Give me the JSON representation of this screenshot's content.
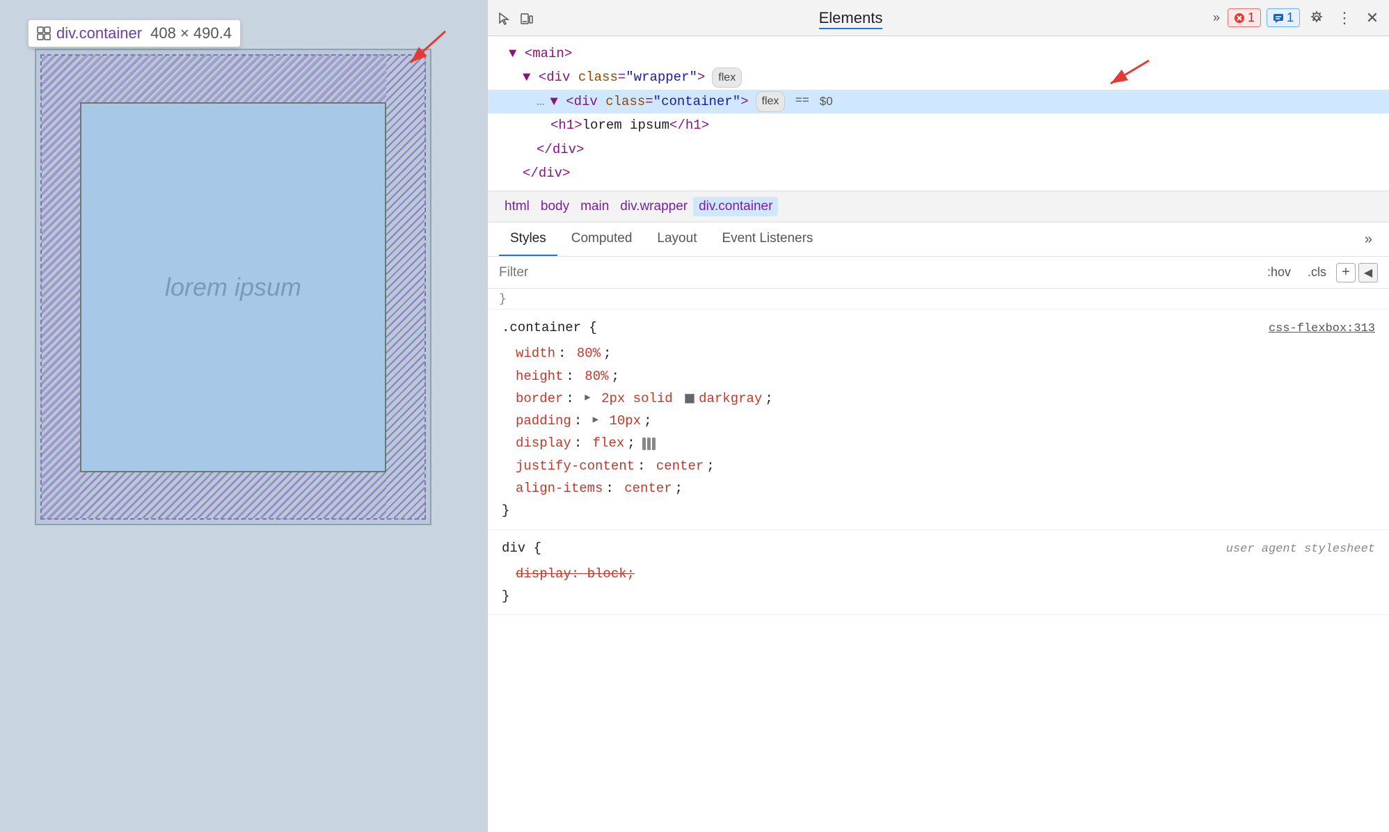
{
  "viewport": {
    "tooltip": {
      "class": "div.container",
      "size": "408 × 490.4"
    },
    "preview": {
      "lorem_text": "lorem ipsum"
    }
  },
  "devtools": {
    "toolbar": {
      "elements_tab": "Elements",
      "more_label": "»",
      "error_badge": "1",
      "info_badge": "1"
    },
    "tree": {
      "main_open": "▼ <main>",
      "wrapper_open": "▼ <div class=\"wrapper\">",
      "wrapper_flex": "flex",
      "container_open": "<div class=\"container\">",
      "container_flex": "flex",
      "container_eq": "==",
      "container_dollar": "$0",
      "h1_open": "<h1>lorem ipsum</h1>",
      "div_close": "</div>",
      "div_close2": "</div>"
    },
    "breadcrumb": {
      "items": [
        "html",
        "body",
        "main",
        "div.wrapper",
        "div.container"
      ]
    },
    "tabs": {
      "items": [
        "Styles",
        "Computed",
        "Layout",
        "Event Listeners"
      ],
      "more": "»",
      "active": "Styles"
    },
    "filter": {
      "placeholder": "Filter",
      "hov_label": ":hov",
      "cls_label": ".cls",
      "plus_label": "+",
      "resize_label": "◀"
    },
    "styles": {
      "rule1": {
        "selector": ".container {",
        "source": "css-flexbox:313",
        "properties": [
          {
            "name": "width",
            "value": "80%",
            "strikethrough": false
          },
          {
            "name": "height",
            "value": "80%",
            "strikethrough": false
          },
          {
            "name": "border",
            "value": "▶ 2px solid",
            "color": "darkgray",
            "has_color": true,
            "strikethrough": false
          },
          {
            "name": "padding",
            "value": "▶ 10px",
            "strikethrough": false
          },
          {
            "name": "display",
            "value": "flex",
            "has_flex_icon": true,
            "strikethrough": false
          },
          {
            "name": "justify-content",
            "value": "center",
            "strikethrough": false
          },
          {
            "name": "align-items",
            "value": "center",
            "strikethrough": false
          }
        ],
        "close": "}"
      },
      "rule2": {
        "selector": "div {",
        "source_italic": "user agent stylesheet",
        "properties": [
          {
            "name": "display: block;",
            "strikethrough": true
          }
        ],
        "close": "}"
      }
    }
  }
}
